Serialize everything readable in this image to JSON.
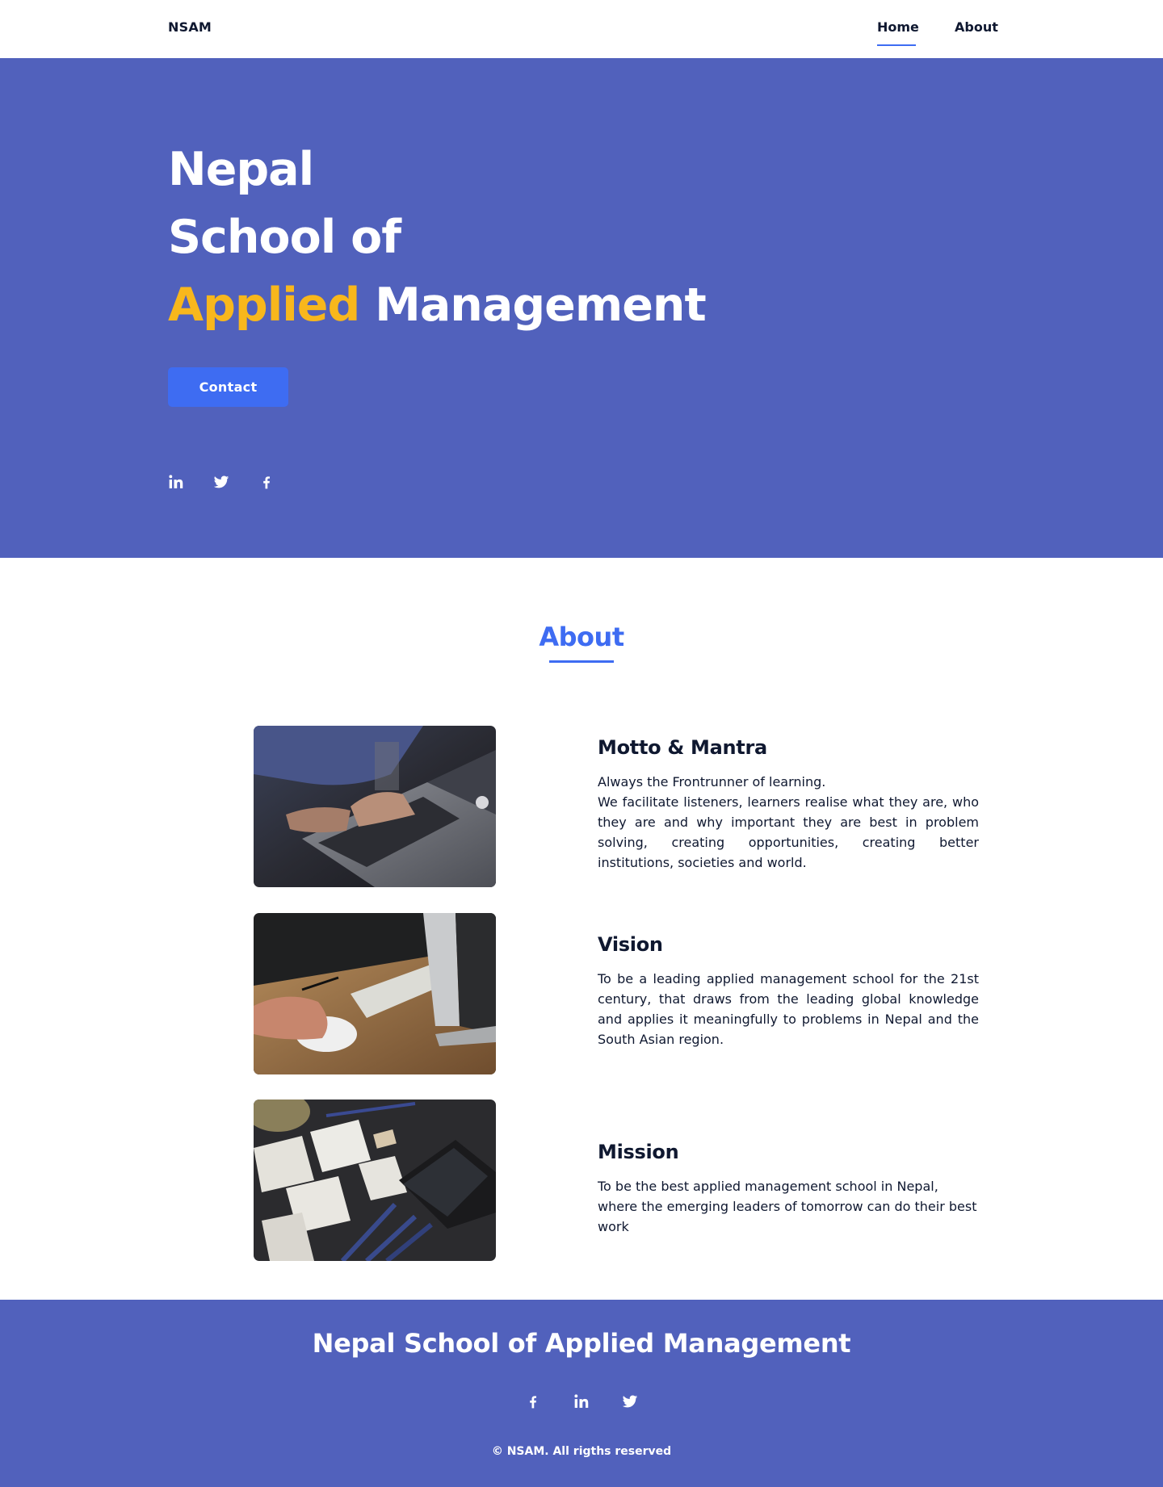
{
  "header": {
    "brand": "NSAM",
    "nav": [
      {
        "label": "Home",
        "active": true
      },
      {
        "label": "About",
        "active": false
      }
    ]
  },
  "hero": {
    "title_line1": "Nepal",
    "title_line2": "School of",
    "title_accent": "Applied",
    "title_rest": "Management",
    "contact_label": "Contact",
    "social_icons": [
      "linkedin-icon",
      "twitter-icon",
      "facebook-icon"
    ]
  },
  "about": {
    "heading": "About",
    "items": [
      {
        "title": "Motto & Mantra",
        "text_line1": "Always the Frontrunner of learning.",
        "text_line2": "We facilitate listeners, learners realise what they are, who they are and why important they are best in problem solving, creating opportunities, creating better institutions, societies and world.",
        "image": "laptop-typing-photo"
      },
      {
        "title": "Vision",
        "text": "To be a leading applied management school for the 21st century, that draws from the leading global knowledge and applies it meaningfully to problems in Nepal and the South Asian region.",
        "image": "desk-mouse-photo"
      },
      {
        "title": "Mission",
        "text": "To be the best applied management school in Nepal, where the emerging leaders of tomorrow can do their best work",
        "image": "sketches-phone-photo"
      }
    ]
  },
  "footer": {
    "title": "Nepal School of Applied Management",
    "social_icons": [
      "facebook-icon",
      "linkedin-icon",
      "twitter-icon"
    ],
    "copyright": "© NSAM. All rigths reserved"
  },
  "colors": {
    "primary": "#5161bc",
    "accent_blue": "#3e6cf2",
    "accent_yellow": "#f8b71c",
    "text_dark": "#0f1830"
  }
}
